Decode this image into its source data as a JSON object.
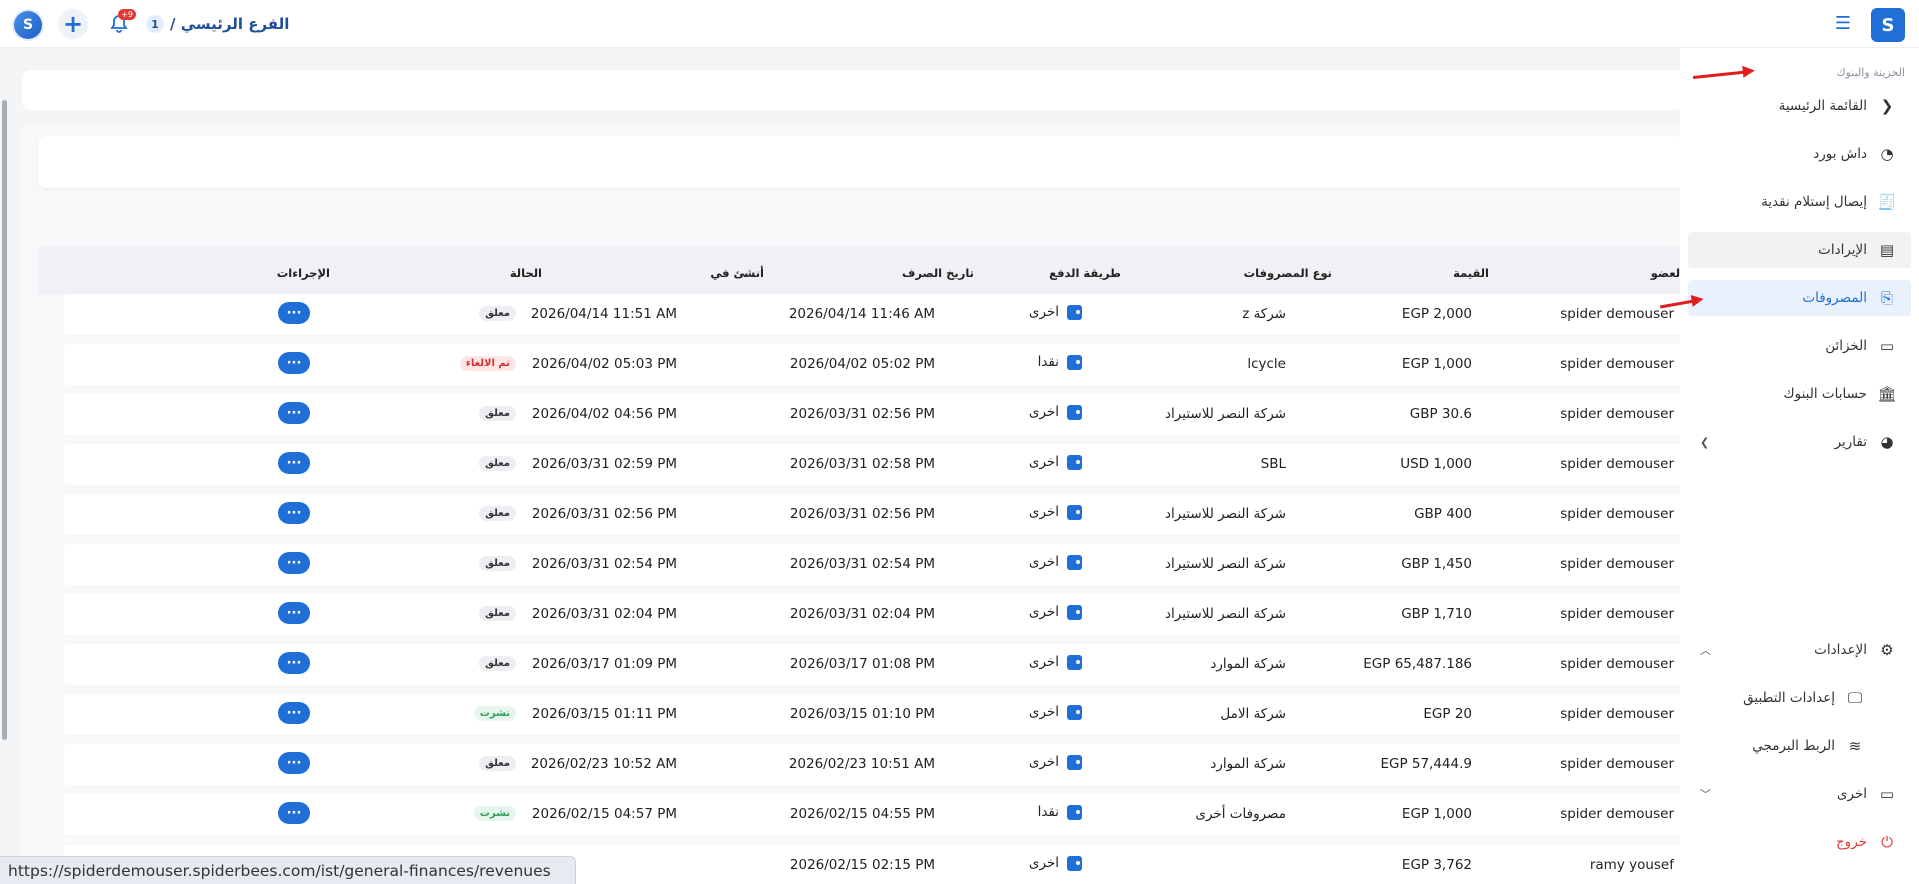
{
  "header": {
    "branch_name": "الفرع الرئيسي /",
    "branch_number": "1",
    "notification_count": "+9",
    "logo_letter": "S"
  },
  "sidebar": {
    "section_title": "الخزينة والبنوك",
    "items": [
      {
        "label": "القائمة الرئيسية",
        "icon": "chevron-left-icon"
      },
      {
        "label": "داش بورد",
        "icon": "gauge-icon"
      },
      {
        "label": "إيصال إستلام نقدية",
        "icon": "receipt-icon"
      },
      {
        "label": "الإيرادات",
        "icon": "revenue-icon"
      },
      {
        "label": "المصروفات",
        "icon": "expense-icon"
      },
      {
        "label": "الخزائن",
        "icon": "safe-icon"
      },
      {
        "label": "حسابات البنوك",
        "icon": "bank-icon"
      },
      {
        "label": "تقارير",
        "icon": "report-icon"
      }
    ],
    "settings": {
      "label": "الإعدادات",
      "icon": "gear-icon"
    },
    "settings_children": [
      {
        "label": "إعدادات التطبيق",
        "icon": "app-settings-icon"
      },
      {
        "label": "الربط البرمجي",
        "icon": "wifi-icon"
      }
    ],
    "other": {
      "label": "اخرى",
      "icon": "window-icon"
    },
    "logout": {
      "label": "خروج",
      "icon": "power-icon"
    }
  },
  "table": {
    "columns": {
      "member": "العضو",
      "value": "القيمة",
      "expense_type": "نوع المصروفات",
      "payment_method": "طريقة الدفع",
      "spend_date": "تاريخ الصرف",
      "created_at": "أنشئ في",
      "status": "الحالة",
      "actions": "الإجراءات"
    },
    "action_label": "···",
    "rows": [
      {
        "member": "spider demouser",
        "value": "EGP 2,000",
        "type": "شركة z",
        "pay": "اخرى",
        "spend": "2026/04/14 11:46 AM",
        "created": "2026/04/14 11:51 AM",
        "status": "معلق",
        "status_kind": "pending"
      },
      {
        "member": "spider demouser",
        "value": "EGP 1,000",
        "type": "lcycle",
        "pay": "نقدا",
        "spend": "2026/04/02 05:02 PM",
        "created": "2026/04/02 05:03 PM",
        "status": "تم الالغاء",
        "status_kind": "cancel"
      },
      {
        "member": "spider demouser",
        "value": "GBP 30.6",
        "type": "شركة النصر للاستيراد",
        "pay": "اخرى",
        "spend": "2026/03/31 02:56 PM",
        "created": "2026/04/02 04:56 PM",
        "status": "معلق",
        "status_kind": "pending"
      },
      {
        "member": "spider demouser",
        "value": "USD 1,000",
        "type": "SBL",
        "pay": "اخرى",
        "spend": "2026/03/31 02:58 PM",
        "created": "2026/03/31 02:59 PM",
        "status": "معلق",
        "status_kind": "pending"
      },
      {
        "member": "spider demouser",
        "value": "GBP 400",
        "type": "شركة النصر للاستيراد",
        "pay": "اخرى",
        "spend": "2026/03/31 02:56 PM",
        "created": "2026/03/31 02:56 PM",
        "status": "معلق",
        "status_kind": "pending"
      },
      {
        "member": "spider demouser",
        "value": "GBP 1,450",
        "type": "شركة النصر للاستيراد",
        "pay": "اخرى",
        "spend": "2026/03/31 02:54 PM",
        "created": "2026/03/31 02:54 PM",
        "status": "معلق",
        "status_kind": "pending"
      },
      {
        "member": "spider demouser",
        "value": "GBP 1,710",
        "type": "شركة النصر للاستيراد",
        "pay": "اخرى",
        "spend": "2026/03/31 02:04 PM",
        "created": "2026/03/31 02:04 PM",
        "status": "معلق",
        "status_kind": "pending"
      },
      {
        "member": "spider demouser",
        "value": "EGP 65,487.186",
        "type": "شركة الموارد",
        "pay": "اخرى",
        "spend": "2026/03/17 01:08 PM",
        "created": "2026/03/17 01:09 PM",
        "status": "معلق",
        "status_kind": "pending"
      },
      {
        "member": "spider demouser",
        "value": "EGP 20",
        "type": "شركة الامل",
        "pay": "اخرى",
        "spend": "2026/03/15 01:10 PM",
        "created": "2026/03/15 01:11 PM",
        "status": "نشرت",
        "status_kind": "published"
      },
      {
        "member": "spider demouser",
        "value": "EGP 57,444.9",
        "type": "شركة الموارد",
        "pay": "اخرى",
        "spend": "2026/02/23 10:51 AM",
        "created": "2026/02/23 10:52 AM",
        "status": "معلق",
        "status_kind": "pending"
      },
      {
        "member": "spider demouser",
        "value": "EGP 1,000",
        "type": "مصروفات أخرى",
        "pay": "نقدا",
        "spend": "2026/02/15 04:55 PM",
        "created": "2026/02/15 04:57 PM",
        "status": "نشرت",
        "status_kind": "published"
      },
      {
        "member": "ramy yousef",
        "value": "EGP 3,762",
        "type": "",
        "pay": "اخرى",
        "spend": "2026/02/15 02:15 PM",
        "created": "",
        "status": "",
        "status_kind": ""
      }
    ]
  },
  "statusbar": {
    "url": "https://spiderdemouser.spiderbees.com/ist/general-finances/revenues"
  }
}
